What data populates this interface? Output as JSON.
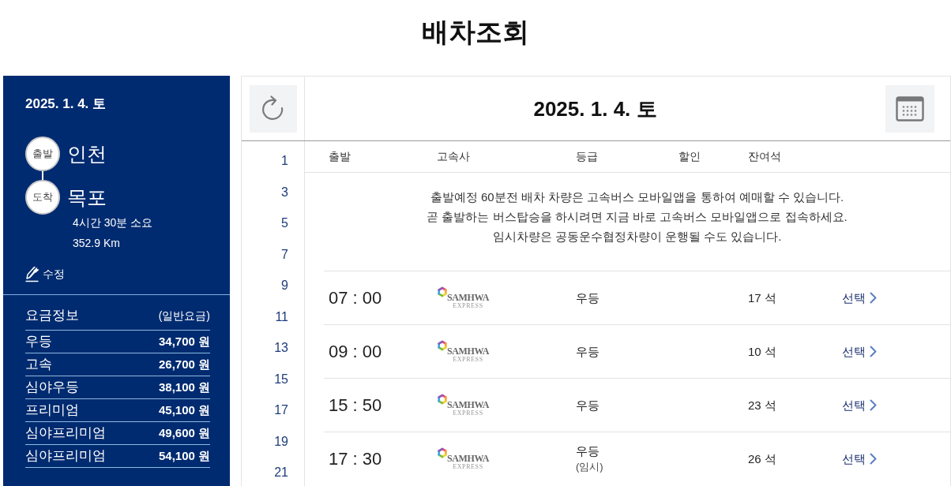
{
  "page": {
    "title": "배차조회"
  },
  "sidebar": {
    "date": "2025. 1. 4. 토",
    "departure": {
      "badge": "출발",
      "city": "인천"
    },
    "arrival": {
      "badge": "도착",
      "city": "목포"
    },
    "duration": "4시간 30분 소요",
    "distance": "352.9 Km",
    "edit_label": "수정",
    "fares": {
      "title": "요금정보",
      "note": "(일반요금)",
      "rows": [
        {
          "grade": "우등",
          "price": "34,700 원"
        },
        {
          "grade": "고속",
          "price": "26,700 원"
        },
        {
          "grade": "심야우등",
          "price": "38,100 원"
        },
        {
          "grade": "프리미엄",
          "price": "45,100 원"
        },
        {
          "grade": "심야프리미엄",
          "price": "49,600 원"
        },
        {
          "grade": "심야프리미엄",
          "price": "54,100 원"
        }
      ]
    }
  },
  "schedule": {
    "date": "2025. 1. 4. 토",
    "hours": [
      "1",
      "3",
      "5",
      "7",
      "9",
      "11",
      "13",
      "15",
      "17",
      "19",
      "21"
    ],
    "columns": [
      "출발",
      "고속사",
      "등급",
      "할인",
      "잔여석"
    ],
    "notice": [
      "출발예정 60분전 배차 차량은 고속버스 모바일앱을 통하여 예매할 수 있습니다.",
      "곧 출발하는 버스탑승을 하시려면 지금 바로 고속버스 모바일앱으로 접속하세요.",
      "임시차량은 공동운수협정차량이 운행될 수도 있습니다."
    ],
    "rows": [
      {
        "time": "07 : 00",
        "company": {
          "name": "SAMHWA",
          "subtitle": "EXPRESS"
        },
        "grade": "우등",
        "seats": "17 석",
        "action": "선택"
      },
      {
        "time": "09 : 00",
        "company": {
          "name": "SAMHWA",
          "subtitle": "EXPRESS"
        },
        "grade": "우등",
        "seats": "10 석",
        "action": "선택"
      },
      {
        "time": "15 : 50",
        "company": {
          "name": "SAMHWA",
          "subtitle": "EXPRESS"
        },
        "grade": "우등",
        "seats": "23 석",
        "action": "선택"
      },
      {
        "time": "17 : 30",
        "company": {
          "name": "SAMHWA",
          "subtitle": "EXPRESS"
        },
        "grade": "우등",
        "grade_note": "(임시)",
        "seats": "26 석",
        "action": "선택"
      }
    ]
  }
}
